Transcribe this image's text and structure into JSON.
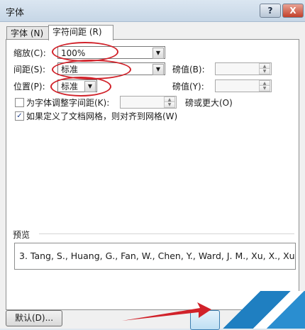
{
  "window": {
    "title": "字体",
    "help_label": "?",
    "close_label": "X"
  },
  "tabs": [
    {
      "label": "字体 (N)",
      "selected": false
    },
    {
      "label": "字符间距 (R)",
      "selected": true
    }
  ],
  "fields": {
    "scale_label": "缩放(C):",
    "scale_value": "100%",
    "spacing_label": "间距(S):",
    "spacing_value": "标准",
    "spacing_by_label": "磅值(B):",
    "position_label": "位置(P):",
    "position_value": "标准",
    "position_by_label": "磅值(Y):",
    "kerning_label": "为字体调整字间距(K):",
    "kerning_checked": false,
    "kerning_suffix": "磅或更大(O)",
    "grid_label": "如果定义了文档网格，则对齐到网格(W)",
    "grid_checked": true
  },
  "preview": {
    "label": "预览",
    "text": "3. Tang, S., Huang, G., Fan, W., Chen, Y., Ward, J. M., Xu, X., Xu,"
  },
  "footer": {
    "default_button": "默认(D)..."
  },
  "icons": {
    "check_glyph": "✓",
    "arrow_glyph": "▼",
    "up_glyph": "▲",
    "down_glyph": "▼"
  },
  "colors": {
    "annotation": "#d1222a",
    "arrow": "#d1222a"
  }
}
